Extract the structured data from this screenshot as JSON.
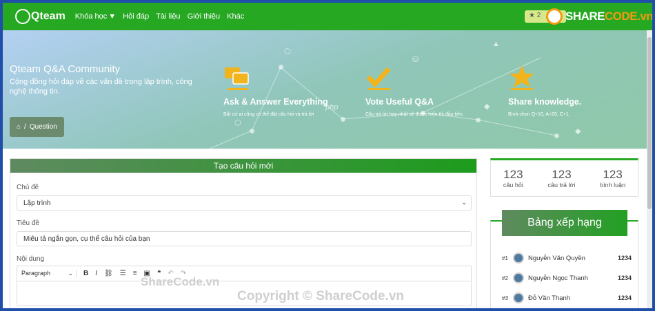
{
  "nav": {
    "brand": "Qteam",
    "menu": [
      "Khóa học",
      "Hỏi đáp",
      "Tài liệu",
      "Giới thiệu",
      "Khác"
    ],
    "badge": "★ 2"
  },
  "sharecode_logo": {
    "share": "SHARE",
    "code": "CODE.vn"
  },
  "hero": {
    "title": "Qteam Q&A Community",
    "subtitle": "Cộng đồng hỏi đáp về các vấn đề trong lập trình, công nghệ thông tin.",
    "breadcrumb": "Question",
    "features": [
      {
        "icon": "chat-bubbles-icon",
        "title": "Ask & Answer Everything",
        "desc": "Bất cứ ai cũng có thể đặt câu hỏi và trả lời"
      },
      {
        "icon": "checkmark-icon",
        "title": "Vote Useful Q&A",
        "desc": "Câu trả lời hay nhất sẽ được hiển thị đầu tiên."
      },
      {
        "icon": "star-icon",
        "title": "Share knowledge.",
        "desc": "Bình chọn Q+10, A+20, C+1."
      }
    ],
    "php": "php"
  },
  "form": {
    "title": "Tạo câu hỏi mới",
    "topic_label": "Chủ đề",
    "topic_value": "Lập trình",
    "title_label": "Tiêu đề",
    "title_placeholder": "Miêu tả ngắn gọn, cụ thể câu hỏi của bạn",
    "content_label": "Nội dung",
    "paragraph": "Paragraph"
  },
  "stats": [
    {
      "n": "123",
      "t": "câu hỏi"
    },
    {
      "n": "123",
      "t": "câu trả lời"
    },
    {
      "n": "123",
      "t": "bình luận"
    }
  ],
  "ranking": {
    "title": "Bảng xếp hạng",
    "rows": [
      {
        "num": "#1",
        "name": "Nguyễn Văn Quyền",
        "score": "1234"
      },
      {
        "num": "#2",
        "name": "Nguyễn Ngọc Thanh",
        "score": "1234"
      },
      {
        "num": "#3",
        "name": "Đỗ Văn Thạnh",
        "score": "1234"
      }
    ]
  },
  "watermarks": {
    "a": "ShareCode.vn",
    "b": "Copyright © ShareCode.vn"
  },
  "colors": {
    "primary": "#26a822",
    "accent": "#f39a12"
  }
}
